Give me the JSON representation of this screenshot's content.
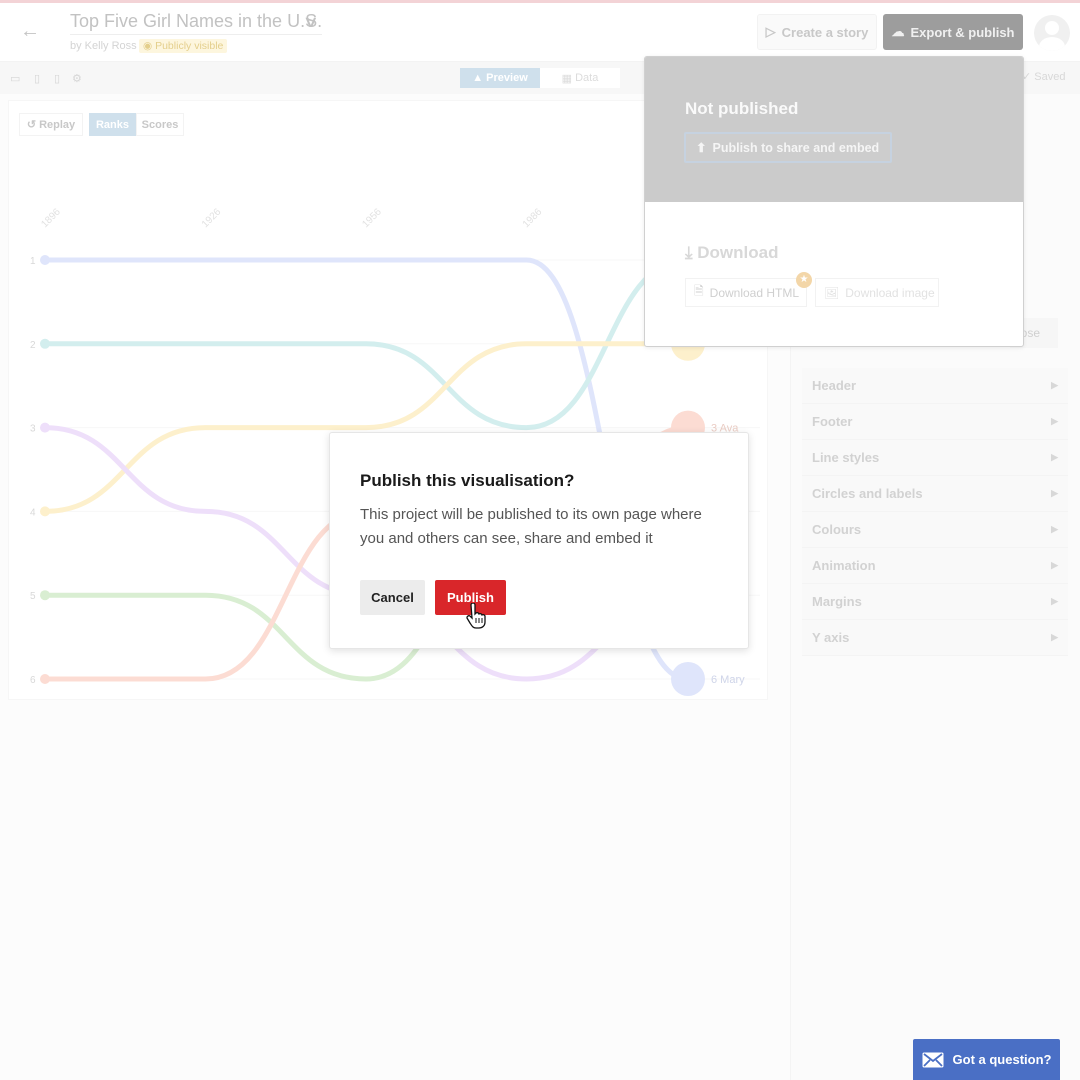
{
  "header": {
    "title": "Top Five Girl Names in the U.S.",
    "byline": "by Kelly Ross",
    "visibility": "Publicly visible",
    "create_story": "Create a story",
    "export_publish": "Export & publish"
  },
  "toolbar": {
    "tabs": [
      {
        "label": "Preview",
        "active": true
      },
      {
        "label": "Data",
        "active": false
      }
    ],
    "saved": "Saved"
  },
  "preview_controls": {
    "replay": "Replay",
    "ranks": "Ranks",
    "scores": "Scores",
    "active": "Ranks"
  },
  "chart_data": {
    "type": "line",
    "subtype": "bump",
    "x_tick_labels": [
      "1896",
      "1926",
      "1956",
      "1986",
      ""
    ],
    "y_tick_labels": [
      "1",
      "2",
      "3",
      "4",
      "5",
      "6"
    ],
    "ylim": [
      1,
      6
    ],
    "y_inverted": true,
    "series": [
      {
        "color": "#dfe5fb",
        "values": [
          1,
          1,
          1,
          1,
          6
        ],
        "end_label": "6 Mary"
      },
      {
        "color": "#d3eeee",
        "values": [
          2,
          2,
          2,
          3,
          1
        ],
        "end_label": ""
      },
      {
        "color": "#fdf0cc",
        "values": [
          4,
          3,
          3,
          2,
          2
        ],
        "end_label": ""
      },
      {
        "color": "#eedffa",
        "values": [
          3,
          4,
          5,
          6,
          5
        ],
        "end_label": ""
      },
      {
        "color": "#d9eed2",
        "values": [
          5,
          5,
          6,
          4,
          4
        ],
        "end_label": ""
      },
      {
        "color": "#fcdcd3",
        "values": [
          6,
          6,
          4,
          5,
          3
        ],
        "end_label": "3 Ava"
      }
    ]
  },
  "side_panel": {
    "close_fragment": "lose",
    "sections": [
      "Header",
      "Footer",
      "Line styles",
      "Circles and labels",
      "Colours",
      "Animation",
      "Margins",
      "Y axis"
    ]
  },
  "export_dropdown": {
    "status": "Not published",
    "publish_button": "Publish to share and embed",
    "download_title": "Download",
    "download_html": "Download HTML",
    "download_image": "Download image"
  },
  "modal": {
    "title": "Publish this visualisation?",
    "body": "This project will be published to its own page where you and others can see, share and embed it",
    "cancel": "Cancel",
    "publish": "Publish"
  },
  "help": {
    "label": "Got a question?"
  },
  "colors": {
    "publish_red": "#d9262a",
    "help_blue": "#4a6fc5"
  }
}
